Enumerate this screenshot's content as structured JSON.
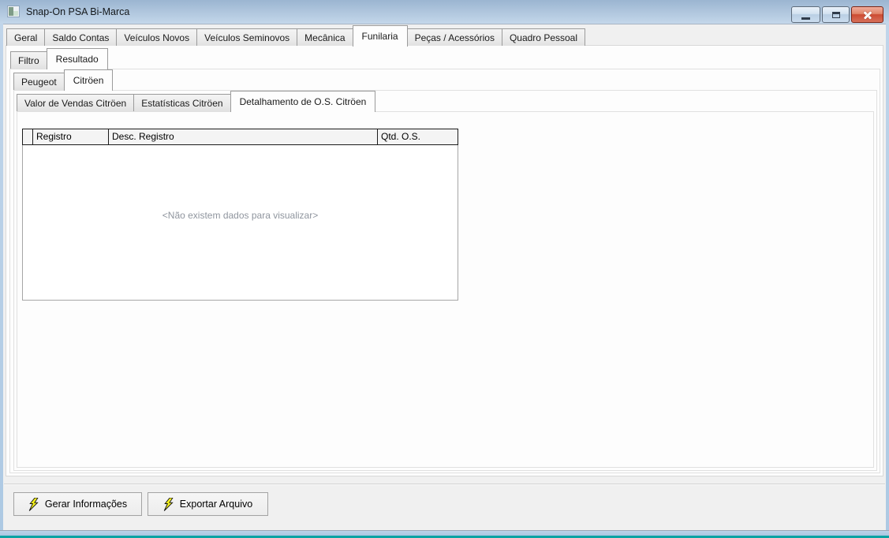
{
  "window": {
    "title": "Snap-On PSA Bi-Marca",
    "controls": [
      {
        "name": "minimize-button",
        "glyph": "minimize"
      },
      {
        "name": "maximize-button",
        "glyph": "maximize"
      },
      {
        "name": "close-button",
        "glyph": "close"
      }
    ]
  },
  "tab_rows": {
    "main": {
      "items": [
        "Geral",
        "Saldo Contas",
        "Veículos Novos",
        "Veículos Seminovos",
        "Mecânica",
        "Funilaria",
        "Peças / Acessórios",
        "Quadro Pessoal"
      ],
      "active": "Funilaria"
    },
    "view": {
      "items": [
        "Filtro",
        "Resultado"
      ],
      "active": "Resultado"
    },
    "brand": {
      "items": [
        "Peugeot",
        "Citröen"
      ],
      "active": "Citröen"
    },
    "report": {
      "items": [
        "Valor de Vendas Citröen",
        "Estatísticas Citröen",
        "Detalhamento de O.S. Citröen"
      ],
      "active": "Detalhamento de O.S. Citröen"
    }
  },
  "grid": {
    "columns": [
      "",
      "Registro",
      "Desc. Registro",
      "Qtd. O.S."
    ],
    "rows": [],
    "empty_message": "<Não existem dados para visualizar>"
  },
  "actions": [
    {
      "name": "gerar-informacoes-button",
      "label": "Gerar Informações",
      "icon": "lightning-icon"
    },
    {
      "name": "exportar-arquivo-button",
      "label": "Exportar Arquivo",
      "icon": "lightning-icon"
    }
  ],
  "colors": {
    "titlebar_top": "#9bb5d1",
    "titlebar_bottom": "#c4d7ea",
    "frame_blue": "#b6cfe7",
    "frame_teal_edge": "#0ba3a3",
    "close_red": "#cc4a31",
    "lightning_yellow": "#f5f11e",
    "form_bg": "#f0f0f0",
    "empty_text_gray": "#8f959e"
  }
}
